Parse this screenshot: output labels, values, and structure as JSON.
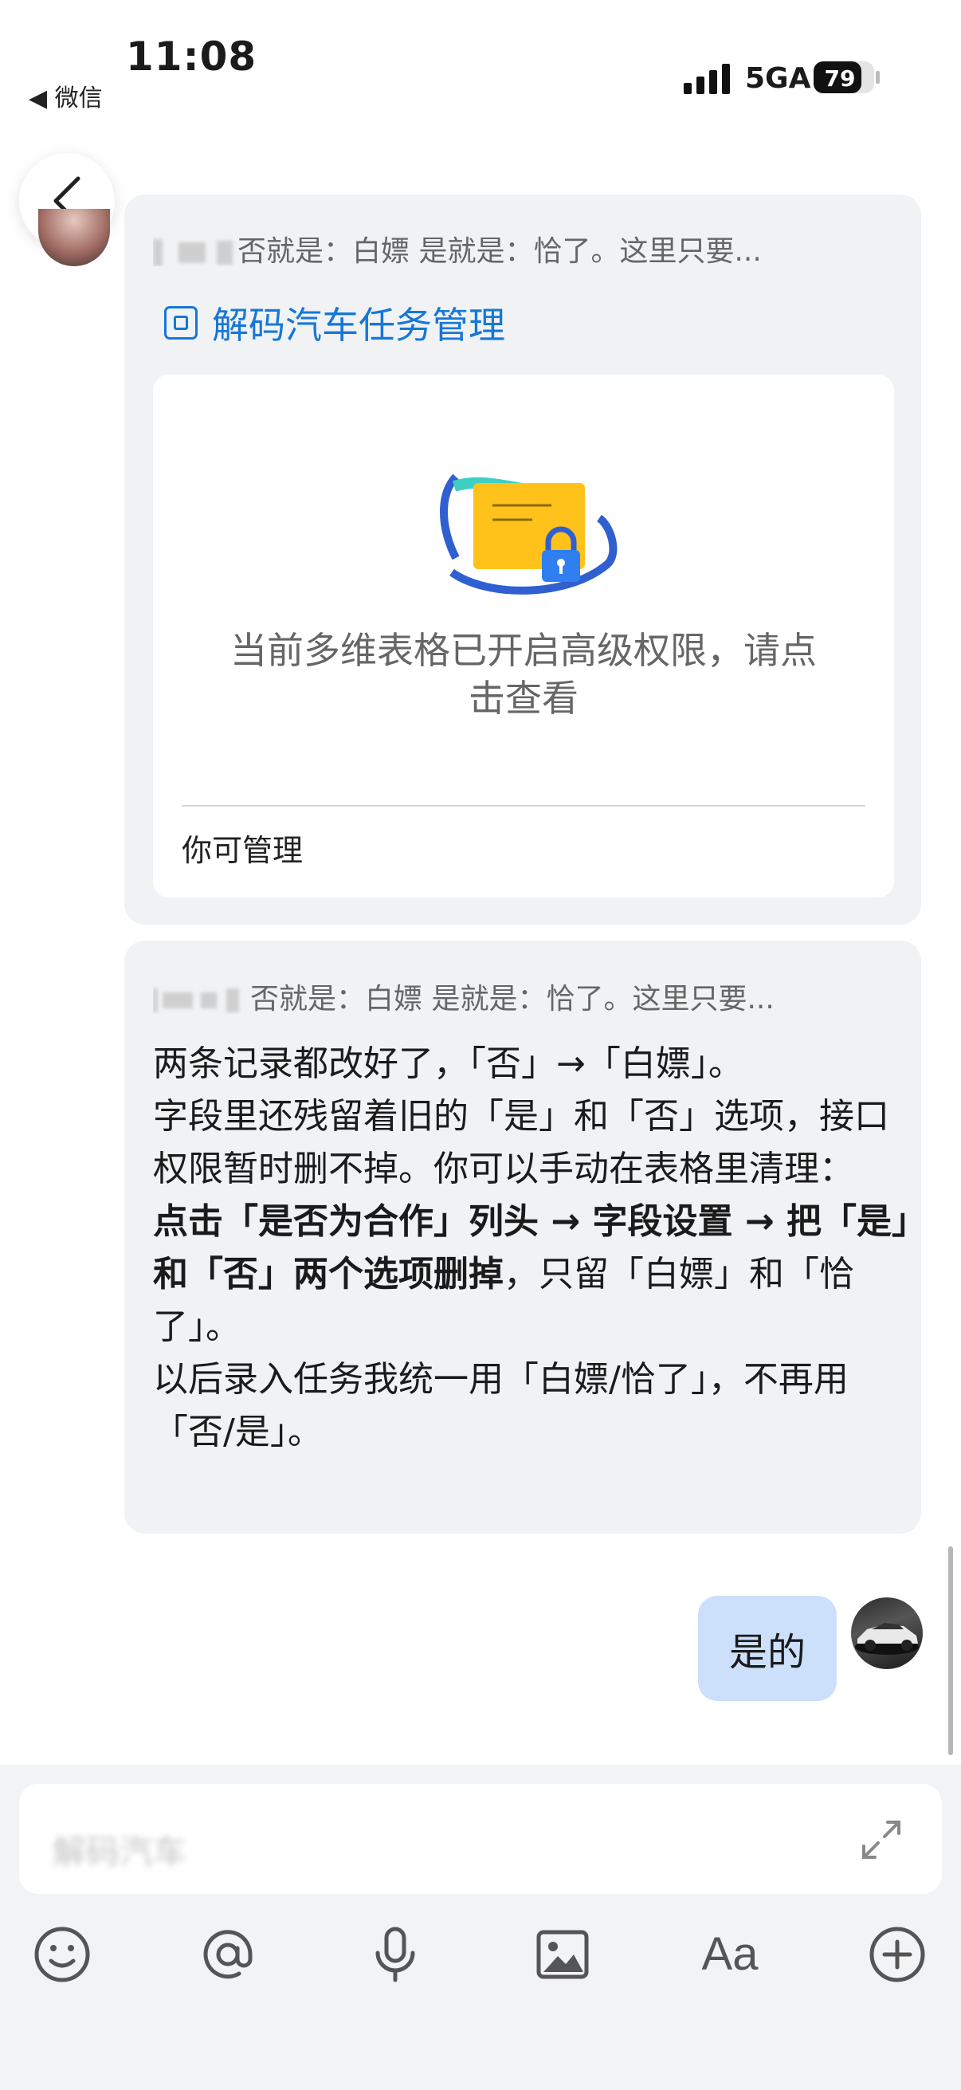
{
  "status_bar": {
    "time": "11:08",
    "back_app": "◀ 微信",
    "network": "5GA",
    "battery": "79"
  },
  "chat": {
    "message1": {
      "quote": "否就是：白嫖 是就是：恰了。这里只要...",
      "doc_title": "解码汽车任务管理",
      "card_text": "当前多维表格已开启高级权限，请点击查看",
      "card_footer": "你可管理"
    },
    "message2": {
      "quote": "否就是：白嫖 是就是：恰了。这里只要...",
      "line1": "两条记录都改好了，「否」→「白嫖」。",
      "line2": "字段里还残留着旧的「是」和「否」选项，接口权限暂时删不掉。你可以手动在表格里清理：",
      "bold": "点击「是否为合作」列头 → 字段设置 → 把「是」和「否」两个选项删掉",
      "after_bold": "，只留「白嫖」和「恰了」。",
      "line4": "以后录入任务我统一用「白嫖/恰了」，不再用「否/是」。"
    },
    "reply": {
      "text": "是的"
    }
  },
  "input": {
    "placeholder": "解码汽车"
  },
  "toolbar": {
    "icons": [
      "emoji-icon",
      "at-icon",
      "microphone-icon",
      "image-icon",
      "font-icon",
      "plus-icon"
    ],
    "font_label": "Aa"
  },
  "colors": {
    "accent": "#1677d8",
    "bubble_left": "#f0f2f4",
    "bubble_right": "#cde0fb",
    "input_bg": "#f2f3f5"
  }
}
